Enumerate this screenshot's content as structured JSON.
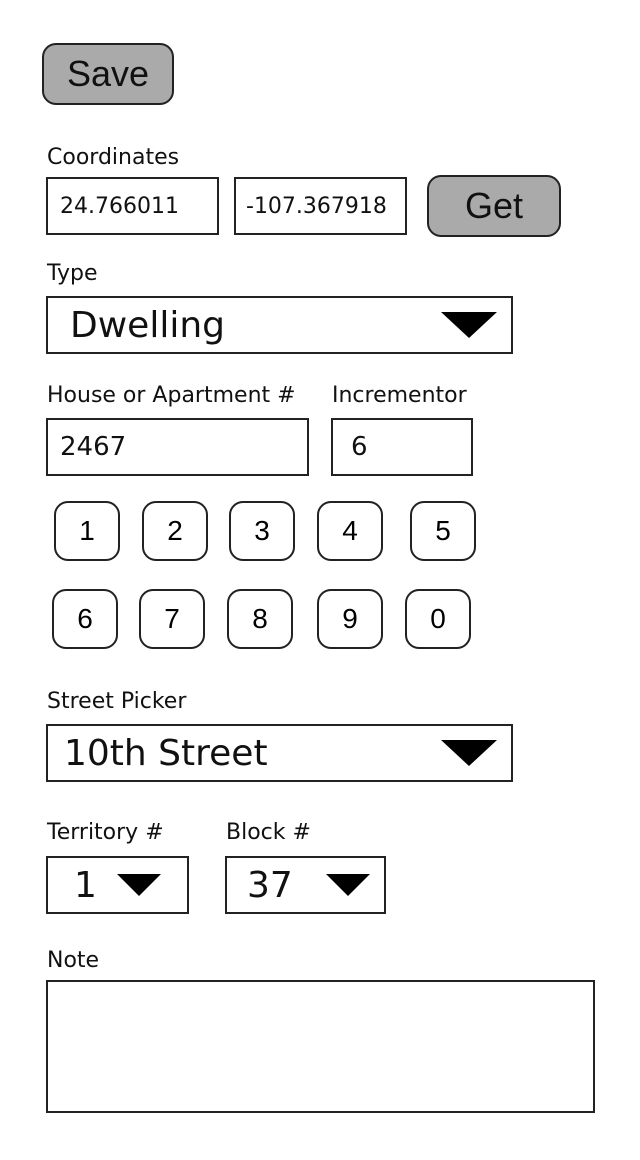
{
  "save_label": "Save",
  "coordinates": {
    "label": "Coordinates",
    "latitude": "24.766011",
    "longitude": "-107.367918",
    "get_label": "Get"
  },
  "type": {
    "label": "Type",
    "selected": "Dwelling"
  },
  "house": {
    "label": "House or Apartment #",
    "value": "2467"
  },
  "incrementor": {
    "label": "Incrementor",
    "value": "6"
  },
  "keypad": {
    "row1": [
      "1",
      "2",
      "3",
      "4",
      "5"
    ],
    "row2": [
      "6",
      "7",
      "8",
      "9",
      "0"
    ]
  },
  "street": {
    "label": "Street Picker",
    "selected": "10th Street"
  },
  "territory": {
    "label": "Territory #",
    "selected": "1"
  },
  "block": {
    "label": "Block #",
    "selected": "37"
  },
  "note": {
    "label": "Note",
    "value": ""
  },
  "colors": {
    "button_fill": "#aaaaaa",
    "border": "#222222",
    "text": "#111111"
  },
  "icons": {
    "dropdown": "triangle-down-icon"
  }
}
